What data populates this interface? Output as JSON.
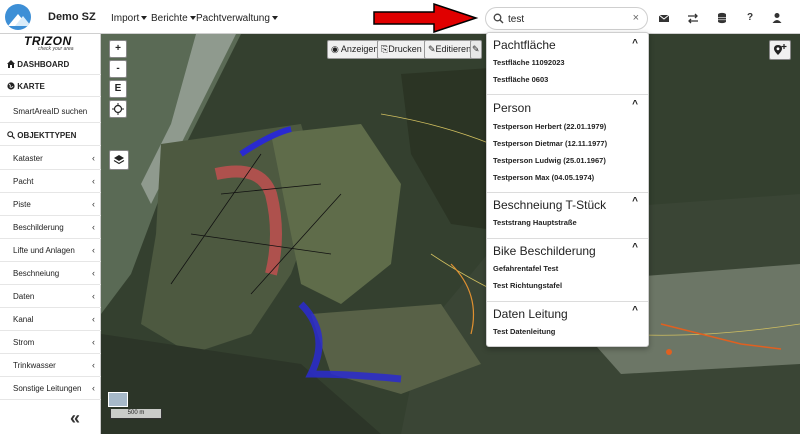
{
  "app": {
    "name": "Demo SZ"
  },
  "nav": {
    "menus": [
      "Import",
      "Berichte",
      "Pachtverwaltung"
    ]
  },
  "search": {
    "value": "test",
    "clear": "×"
  },
  "toolbar_icons": [
    "mail-icon",
    "swap-icon",
    "database-icon",
    "help-icon",
    "user-icon"
  ],
  "toolbar_glyphs": {
    "help": "?"
  },
  "brand": {
    "word": "TRIZON",
    "tagline": "check your area"
  },
  "sidebar": {
    "dashboard": "DASHBOARD",
    "karte": "KARTE",
    "smartarea": "SmartAreaID suchen",
    "objekttypen": "OBJEKTTYPEN",
    "items": [
      "Kataster",
      "Pacht",
      "Piste",
      "Beschilderung",
      "Lifte und Anlagen",
      "Beschneiung",
      "Daten",
      "Kanal",
      "Strom",
      "Trinkwasser",
      "Sonstige Leitungen"
    ],
    "chevron": "‹",
    "collapse": "«"
  },
  "map": {
    "zoom_in": "+",
    "zoom_out": "-",
    "e_button": "E",
    "tools": {
      "anzeigen": "Anzeigen",
      "drucken": "Drucken",
      "editieren": "Editieren"
    },
    "scale": "500 m"
  },
  "results": {
    "groups": [
      {
        "title": "Pachtfläche",
        "items": [
          "Testfläche 11092023",
          "Testfläche 0603"
        ]
      },
      {
        "title": "Person",
        "items": [
          "Testperson Herbert (22.01.1979)",
          "Testperson Dietmar (12.11.1977)",
          "Testperson Ludwig (25.01.1967)",
          "Testperson Max (04.05.1974)"
        ]
      },
      {
        "title": "Beschneiung T-Stück",
        "items": [
          "Teststrang Hauptstraße"
        ]
      },
      {
        "title": "Bike Beschilderung",
        "items": [
          "Gefahrentafel Test",
          "Test Richtungstafel"
        ]
      },
      {
        "title": "Daten Leitung",
        "items": [
          "Test Datenleitung"
        ]
      }
    ],
    "chevron": "^"
  },
  "colors": {
    "accent": "#3d8fd6",
    "arrow": "#e00000",
    "map_bg": "#2f3a30"
  }
}
